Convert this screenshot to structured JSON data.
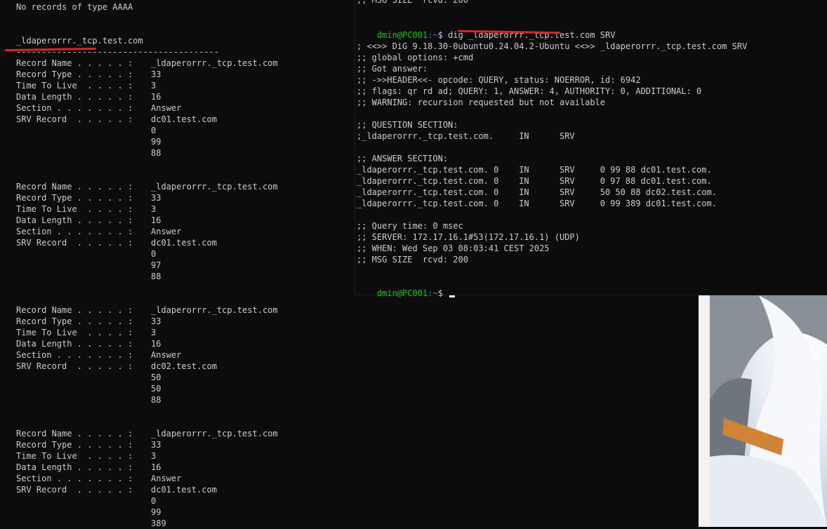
{
  "cmd": {
    "no_records": "No records of type AAAA",
    "query_name": "_ldaperorrr._tcp.test.com",
    "separator": "----------------------------------------",
    "labels": {
      "name": "Record Name . . . . . :",
      "type": "Record Type . . . . . :",
      "ttl": "Time To Live  . . . . :",
      "len": "Data Length . . . . . :",
      "section": "Section . . . . . . . :",
      "srv": "SRV Record  . . . . . :"
    },
    "records": [
      {
        "name": "_ldaperorrr._tcp.test.com",
        "type": "33",
        "ttl": "3",
        "len": "16",
        "section": "Answer",
        "target": "dc01.test.com",
        "priority": "0",
        "weight": "99",
        "port": "88"
      },
      {
        "name": "_ldaperorrr._tcp.test.com",
        "type": "33",
        "ttl": "3",
        "len": "16",
        "section": "Answer",
        "target": "dc01.test.com",
        "priority": "0",
        "weight": "97",
        "port": "88"
      },
      {
        "name": "_ldaperorrr._tcp.test.com",
        "type": "33",
        "ttl": "3",
        "len": "16",
        "section": "Answer",
        "target": "dc02.test.com",
        "priority": "50",
        "weight": "50",
        "port": "88"
      },
      {
        "name": "_ldaperorrr._tcp.test.com",
        "type": "33",
        "ttl": "3",
        "len": "16",
        "section": "Answer",
        "target": "dc01.test.com",
        "priority": "0",
        "weight": "99",
        "port": "389"
      }
    ]
  },
  "wsl": {
    "top_cut": ";; MSG SIZE  rcvd: 200",
    "prompt_user": "dmin@PC001",
    "prompt_path": ":~",
    "prompt_sign": "$ ",
    "command": "dig _ldaperorrr._tcp.test.com SRV",
    "lines": [
      "; <<>> DiG 9.18.30-0ubuntu0.24.04.2-Ubuntu <<>> _ldaperorrr._tcp.test.com SRV",
      ";; global options: +cmd",
      ";; Got answer:",
      ";; ->>HEADER<<- opcode: QUERY, status: NOERROR, id: 6942",
      ";; flags: qr rd ad; QUERY: 1, ANSWER: 4, AUTHORITY: 0, ADDITIONAL: 0",
      ";; WARNING: recursion requested but not available",
      "",
      ";; QUESTION SECTION:",
      ";_ldaperorrr._tcp.test.com.     IN      SRV",
      "",
      ";; ANSWER SECTION:",
      "_ldaperorrr._tcp.test.com. 0    IN      SRV     0 99 88 dc01.test.com.",
      "_ldaperorrr._tcp.test.com. 0    IN      SRV     0 97 88 dc01.test.com.",
      "_ldaperorrr._tcp.test.com. 0    IN      SRV     50 50 88 dc02.test.com.",
      "_ldaperorrr._tcp.test.com. 0    IN      SRV     0 99 389 dc01.test.com.",
      "",
      ";; Query time: 0 msec",
      ";; SERVER: 172.17.16.1#53(172.17.16.1) (UDP)",
      ";; WHEN: Wed Sep 03 08:03:41 CEST 2025",
      ";; MSG SIZE  rcvd: 200"
    ]
  },
  "colors": {
    "prompt_user": "#16c60c",
    "prompt_path": "#3b78ff",
    "annotation": "#d8242e"
  }
}
